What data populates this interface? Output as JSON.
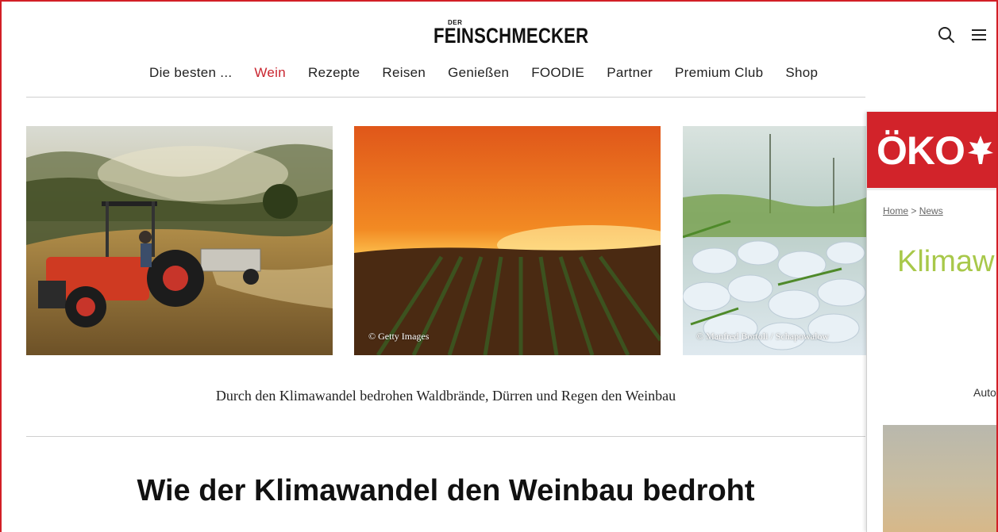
{
  "header": {
    "logo_small": "DER",
    "logo_main": "FEINSCHMECKER",
    "icons": {
      "search": "search-icon",
      "menu": "hamburger-menu-icon"
    }
  },
  "nav": {
    "items": [
      {
        "label": "Die besten ...",
        "active": false
      },
      {
        "label": "Wein",
        "active": true
      },
      {
        "label": "Rezepte",
        "active": false
      },
      {
        "label": "Reisen",
        "active": false
      },
      {
        "label": "Genießen",
        "active": false
      },
      {
        "label": "FOODIE",
        "active": false
      },
      {
        "label": "Partner",
        "active": false
      },
      {
        "label": "Premium Club",
        "active": false
      },
      {
        "label": "Shop",
        "active": false
      }
    ]
  },
  "gallery": {
    "images": [
      {
        "name": "tractor-vineyard-image",
        "credit": ""
      },
      {
        "name": "wildfire-vineyard-image",
        "credit": "© Getty Images"
      },
      {
        "name": "hail-field-image",
        "credit": "© Manfred Bortoli / Schapowalow"
      }
    ],
    "caption": "Durch den Klimawandel bedrohen Waldbrände, Dürren und Regen den Weinbau"
  },
  "article": {
    "headline": "Wie der Klimawandel den Weinbau bedroht"
  },
  "overlay_page": {
    "logo": "ÖKO",
    "brand_color": "#d2232a",
    "breadcrumb": {
      "home": "Home",
      "separator": ">",
      "news": "News"
    },
    "title_fragment": "Klimaw",
    "title_color": "#a8c84a",
    "author_fragment": "Auto"
  },
  "colors": {
    "accent": "#c9252f",
    "frame": "#d21f26"
  }
}
